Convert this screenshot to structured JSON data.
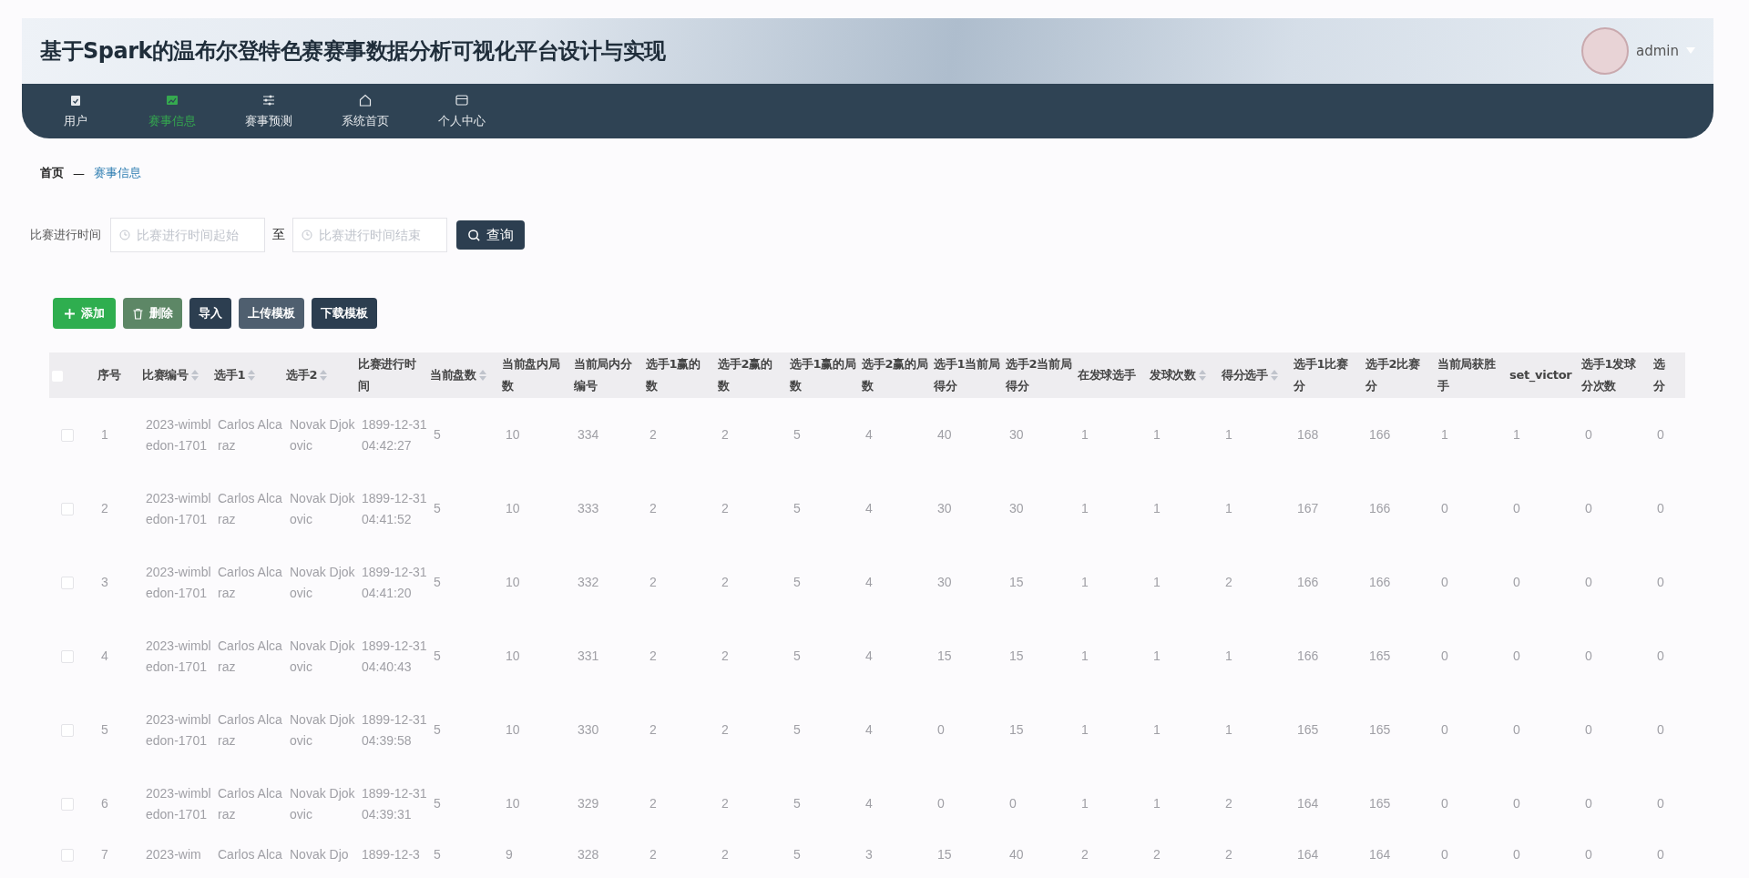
{
  "header": {
    "title": "基于Spark的温布尔登特色赛赛事数据分析可视化平台设计与实现",
    "user": "admin"
  },
  "nav": [
    {
      "label": "用户",
      "selected": false
    },
    {
      "label": "赛事信息",
      "selected": true
    },
    {
      "label": "赛事预测",
      "selected": false
    },
    {
      "label": "系统首页",
      "selected": false
    },
    {
      "label": "个人中心",
      "selected": false
    }
  ],
  "breadcrumb": [
    "首页",
    "—",
    "赛事信息"
  ],
  "filter": {
    "label": "比赛进行时间",
    "start_placeholder": "比赛进行时间起始",
    "separator": "至",
    "end_placeholder": "比赛进行时间结束",
    "search_button": "查询"
  },
  "actions": [
    {
      "label": "添加",
      "kind": "add"
    },
    {
      "label": "删除",
      "kind": "delete"
    },
    {
      "label": "导入",
      "kind": "plain"
    },
    {
      "label": "上传模板",
      "kind": "hover"
    },
    {
      "label": "下载模板",
      "kind": "plain"
    }
  ],
  "table": {
    "all_checked": false,
    "columns": [
      {
        "lines": [
          "序号"
        ],
        "sortable": false
      },
      {
        "lines": [
          "比赛编号"
        ],
        "sortable": true
      },
      {
        "lines": [
          "选手1"
        ],
        "sortable": true
      },
      {
        "lines": [
          "选手2"
        ],
        "sortable": true
      },
      {
        "lines": [
          "比赛进行时",
          "间"
        ],
        "sortable": false
      },
      {
        "lines": [
          "当前盘数"
        ],
        "sortable": true
      },
      {
        "lines": [
          "当前盘内局",
          "数"
        ],
        "sortable": false
      },
      {
        "lines": [
          "当前局内分",
          "编号"
        ],
        "sortable": false
      },
      {
        "lines": [
          "选手1赢的",
          "数"
        ],
        "sortable": false
      },
      {
        "lines": [
          "选手2赢的",
          "数"
        ],
        "sortable": false
      },
      {
        "lines": [
          "选手1赢的局",
          "数"
        ],
        "sortable": false
      },
      {
        "lines": [
          "选手2赢的局",
          "数"
        ],
        "sortable": false
      },
      {
        "lines": [
          "选手1当前局",
          "得分"
        ],
        "sortable": false
      },
      {
        "lines": [
          "选手2当前局",
          "得分"
        ],
        "sortable": false
      },
      {
        "lines": [
          "在发球选手"
        ],
        "sortable": false
      },
      {
        "lines": [
          "发球次数"
        ],
        "sortable": true
      },
      {
        "lines": [
          "得分选手"
        ],
        "sortable": true
      },
      {
        "lines": [
          "选手1比赛",
          "分"
        ],
        "sortable": false
      },
      {
        "lines": [
          "选手2比赛",
          "分"
        ],
        "sortable": false
      },
      {
        "lines": [
          "当前局获胜",
          "手"
        ],
        "sortable": false
      },
      {
        "lines": [
          "set_victor"
        ],
        "sortable": false
      },
      {
        "lines": [
          "选手1发球",
          "分次数"
        ],
        "sortable": false
      },
      {
        "lines": [
          "选",
          "分"
        ],
        "sortable": false
      }
    ],
    "rows": [
      {
        "checked": false,
        "cells": [
          "1",
          "2023-wimbledon-1701",
          "Carlos Alcaraz",
          "Novak Djokovic",
          "1899-12-31 04:42:27",
          "5",
          "10",
          "334",
          "2",
          "2",
          "5",
          "4",
          "40",
          "30",
          "1",
          "1",
          "1",
          "168",
          "166",
          "1",
          "1",
          "0",
          "0"
        ]
      },
      {
        "checked": false,
        "cells": [
          "2",
          "2023-wimbledon-1701",
          "Carlos Alcaraz",
          "Novak Djokovic",
          "1899-12-31 04:41:52",
          "5",
          "10",
          "333",
          "2",
          "2",
          "5",
          "4",
          "30",
          "30",
          "1",
          "1",
          "1",
          "167",
          "166",
          "0",
          "0",
          "0",
          "0"
        ]
      },
      {
        "checked": false,
        "cells": [
          "3",
          "2023-wimbledon-1701",
          "Carlos Alcaraz",
          "Novak Djokovic",
          "1899-12-31 04:41:20",
          "5",
          "10",
          "332",
          "2",
          "2",
          "5",
          "4",
          "30",
          "15",
          "1",
          "1",
          "2",
          "166",
          "166",
          "0",
          "0",
          "0",
          "0"
        ]
      },
      {
        "checked": false,
        "cells": [
          "4",
          "2023-wimbledon-1701",
          "Carlos Alcaraz",
          "Novak Djokovic",
          "1899-12-31 04:40:43",
          "5",
          "10",
          "331",
          "2",
          "2",
          "5",
          "4",
          "15",
          "15",
          "1",
          "1",
          "1",
          "166",
          "165",
          "0",
          "0",
          "0",
          "0"
        ]
      },
      {
        "checked": false,
        "cells": [
          "5",
          "2023-wimbledon-1701",
          "Carlos Alcaraz",
          "Novak Djokovic",
          "1899-12-31 04:39:58",
          "5",
          "10",
          "330",
          "2",
          "2",
          "5",
          "4",
          "0",
          "15",
          "1",
          "1",
          "1",
          "165",
          "165",
          "0",
          "0",
          "0",
          "0"
        ]
      },
      {
        "checked": false,
        "cells": [
          "6",
          "2023-wimbledon-1701",
          "Carlos Alcaraz",
          "Novak Djokovic",
          "1899-12-31 04:39:31",
          "5",
          "10",
          "329",
          "2",
          "2",
          "5",
          "4",
          "0",
          "0",
          "1",
          "1",
          "2",
          "164",
          "165",
          "0",
          "0",
          "0",
          "0"
        ]
      },
      {
        "checked": false,
        "cells": [
          "7",
          "2023-wim",
          "Carlos Alca",
          "Novak Djo",
          "1899-12-3",
          "5",
          "9",
          "328",
          "2",
          "2",
          "5",
          "3",
          "15",
          "40",
          "2",
          "2",
          "2",
          "164",
          "164",
          "0",
          "0",
          "0",
          "0"
        ]
      }
    ]
  }
}
